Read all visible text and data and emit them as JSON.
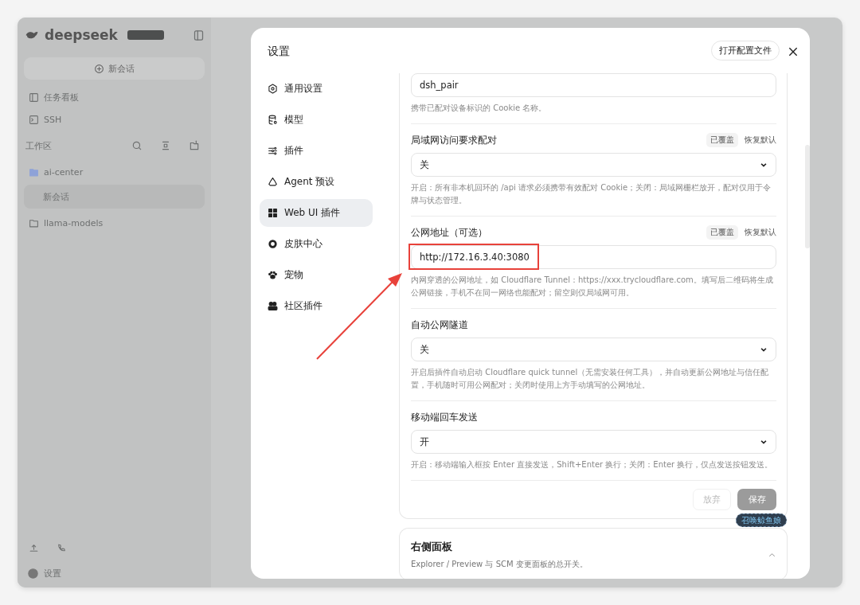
{
  "app": {
    "brand": "deepseek",
    "new_chat": "新会话",
    "nav": [
      {
        "label": "任务看板"
      },
      {
        "label": "SSH"
      }
    ],
    "workspace_label": "工作区",
    "folders": [
      {
        "name": "ai-center",
        "expanded": true,
        "children": [
          {
            "label": "新会话",
            "selected": true
          }
        ]
      },
      {
        "name": "llama-models",
        "expanded": false
      }
    ],
    "settings_label": "设置"
  },
  "dialog": {
    "title": "设置",
    "open_config_button": "打开配置文件",
    "nav": [
      {
        "label": "通用设置",
        "selected": false
      },
      {
        "label": "模型",
        "selected": false
      },
      {
        "label": "插件",
        "selected": false
      },
      {
        "label": "Agent 预设",
        "selected": false
      },
      {
        "label": "Web UI 插件",
        "selected": true
      },
      {
        "label": "皮肤中心",
        "selected": false
      },
      {
        "label": "宠物",
        "selected": false
      },
      {
        "label": "社区插件",
        "selected": false
      }
    ],
    "settings": [
      {
        "kind": "input",
        "value": "dsh_pair",
        "hint": "携带已配对设备标识的 Cookie 名称。"
      },
      {
        "kind": "select",
        "label": "局域网访问要求配对",
        "overridden_tag": "已覆盖",
        "reset": "恢复默认",
        "value": "关",
        "hint": "开启：所有非本机回环的 /api 请求必须携带有效配对 Cookie；关闭：局域网栅栏放开，配对仅用于令牌与状态管理。"
      },
      {
        "kind": "input",
        "label": "公网地址（可选）",
        "overridden_tag": "已覆盖",
        "reset": "恢复默认",
        "value": "http://172.16.3.40:3080",
        "highlighted": true,
        "hint": "内网穿透的公网地址，如 Cloudflare Tunnel：https://xxx.trycloudflare.com。填写后二维码将生成公网链接，手机不在同一网络也能配对；留空则仅局域网可用。"
      },
      {
        "kind": "select",
        "label": "自动公网隧道",
        "value": "关",
        "hint": "开启后插件自动启动 Cloudflare quick tunnel（无需安装任何工具），并自动更新公网地址与信任配置，手机随时可用公网配对；关闭时使用上方手动填写的公网地址。"
      },
      {
        "kind": "select",
        "label": "移动端回车发送",
        "value": "开",
        "hint": "开启：移动端输入框按 Enter 直接发送，Shift+Enter 换行；关闭：Enter 换行，仅点发送按钮发送。"
      }
    ],
    "discard_button": "放弃",
    "discard_disabled": true,
    "save_button": "保存",
    "mascot_badge": "召唤鲸鱼娘",
    "panels": [
      {
        "title": "右侧面板",
        "description": "Explorer / Preview 与 SCM 变更面板的总开关。",
        "expanded": true
      }
    ]
  }
}
